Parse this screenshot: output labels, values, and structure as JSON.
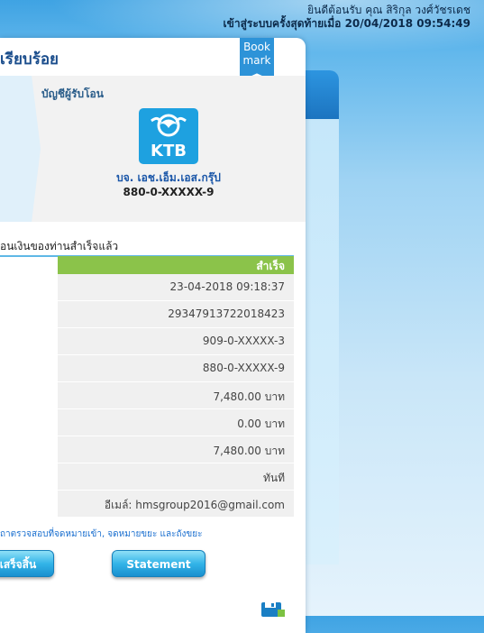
{
  "header": {
    "welcome": "ยินดีต้อนรับ คุณ สิริกุล วงศ์วัชรเดช",
    "last_login": "เข้าสู่ระบบครั้งสุดท้ายเมื่อ 20/04/2018 09:54:49"
  },
  "page": {
    "title": "เรียบร้อย",
    "bookmark": "Book mark"
  },
  "recipient": {
    "label": "บัญชีผู้รับโอน",
    "bank_logo": "KTB",
    "name": "บจ. เอช.เอ็ม.เอส.กรุ๊ป",
    "account": "880-0-XXXXX-9"
  },
  "result": {
    "section_title": "อนเงินของท่านสำเร็จแล้ว",
    "status": "สำเร็จ",
    "rows": [
      "23-04-2018 09:18:37",
      "29347913722018423",
      "909-0-XXXXX-3",
      "880-0-XXXXX-9",
      "7,480.00 บาท",
      "0.00 บาท",
      "7,480.00 บาท",
      "ทันที",
      "อีเมล์: hmsgroup2016@gmail.com"
    ]
  },
  "note": "ถาตรวจสอบที่จดหมายเข้า, จดหมายขยะ และถังขยะ",
  "buttons": {
    "finish": "เสร็จสิ้น",
    "statement": "Statement"
  },
  "icons": {
    "bookmark": "bookmark-icon",
    "logo": "ktb-logo-icon",
    "save": "save-icon"
  },
  "colors": {
    "status_bg": "#8bc34a",
    "accent": "#2d93d8",
    "title": "#1a4d8c"
  }
}
